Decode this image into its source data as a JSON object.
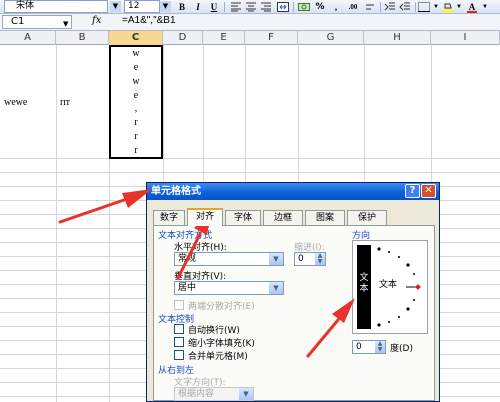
{
  "toolbar": {
    "font_name": "宋体",
    "font_size": "12",
    "bold": "B",
    "italic": "I",
    "underline": "U",
    "percent": "%",
    "comma": ",",
    "decimals_inc": ".00",
    "font_color_label": "A"
  },
  "formula_bar": {
    "name_box": "C1",
    "fx": "fx",
    "formula": "=A1&\",\"&B1"
  },
  "columns": [
    "A",
    "B",
    "C",
    "D",
    "E",
    "F",
    "G",
    "H",
    "I"
  ],
  "active_column": "C",
  "cells": {
    "A1": "wewe",
    "B1": "rrr",
    "C1_chars": [
      "w",
      "e",
      "w",
      "e",
      ",",
      "r",
      "r",
      "r"
    ]
  },
  "dialog": {
    "title": "单元格格式",
    "help": "?",
    "close": "✕",
    "tabs": [
      "数字",
      "对齐",
      "字体",
      "边框",
      "图案",
      "保护"
    ],
    "active_tab": "对齐",
    "text_align_section": "文本对齐方式",
    "horizontal_label": "水平对齐(H):",
    "horizontal_value": "常规",
    "indent_label": "缩进(I):",
    "indent_value": "0",
    "vertical_label": "垂直对齐(V):",
    "vertical_value": "居中",
    "justify_distributed": "两端分散对齐(E)",
    "text_control_section": "文本控制",
    "wrap_text": "自动换行(W)",
    "shrink_to_fit": "缩小字体填充(K)",
    "merge_cells": "合并单元格(M)",
    "rtl_section": "从右到左",
    "text_direction_label": "文字方向(T):",
    "text_direction_value": "根据内容",
    "orientation_section": "方向",
    "orientation_vertical_text": [
      "文",
      "本"
    ],
    "orientation_text": "文本",
    "degrees_value": "0",
    "degrees_label": "度(D)"
  },
  "colors": {
    "arrow": "#e8332a",
    "dialog_title": "#0a5fd8",
    "section_label": "#1a48c8"
  }
}
